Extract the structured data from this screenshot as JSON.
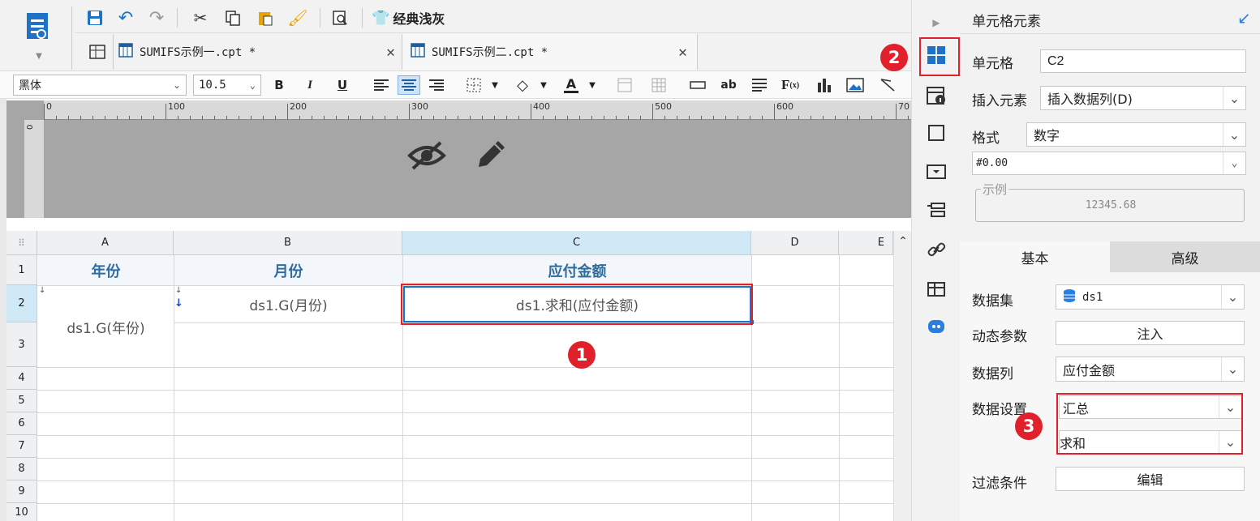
{
  "toolbar": {
    "theme_label": "经典浅灰"
  },
  "tabs": [
    {
      "label": "SUMIFS示例一.cpt *"
    },
    {
      "label": "SUMIFS示例二.cpt *"
    }
  ],
  "format": {
    "font": "黑体",
    "size": "10.5"
  },
  "ruler": {
    "ticks": [
      "0",
      "100",
      "200",
      "300",
      "400",
      "500",
      "600",
      "70"
    ]
  },
  "columns": [
    "A",
    "B",
    "C",
    "D",
    "E"
  ],
  "rows": [
    "1",
    "2",
    "3",
    "4",
    "5",
    "6",
    "7",
    "8",
    "9",
    "10"
  ],
  "header_cells": {
    "a1": "年份",
    "b1": "月份",
    "c1": "应付金额"
  },
  "cells": {
    "a2": "ds1.G(年份)",
    "b2": "ds1.G(月份)",
    "c2": "ds1.求和(应付金额)"
  },
  "panel": {
    "title": "单元格元素",
    "cell_label": "单元格",
    "cell_value": "C2",
    "insert_label": "插入元素",
    "insert_value": "插入数据列(D)",
    "format_label": "格式",
    "format_value": "数字",
    "pattern_value": "#0.00",
    "example_label": "示例",
    "example_value": "12345.68",
    "tab_basic": "基本",
    "tab_advanced": "高级",
    "dataset_label": "数据集",
    "dataset_value": "ds1",
    "param_label": "动态参数",
    "param_button": "注入",
    "column_label": "数据列",
    "column_value": "应付金额",
    "setting_label": "数据设置",
    "setting_value": "汇总",
    "setting_sub_value": "求和",
    "filter_label": "过滤条件",
    "filter_button": "编辑"
  },
  "badges": [
    "1",
    "2",
    "3"
  ],
  "colors": {
    "accent": "#1e73c8",
    "annotation": "#e0202a",
    "header_text": "#2e6d9e"
  }
}
